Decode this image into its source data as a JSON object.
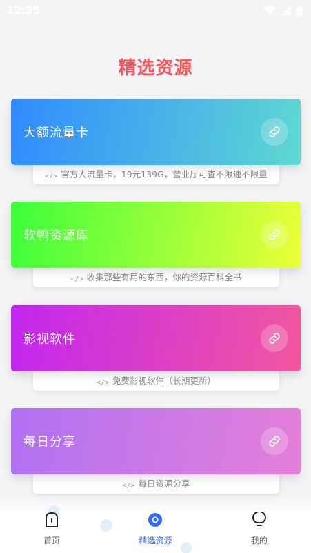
{
  "status_bar": {
    "time": "12:35"
  },
  "page_title": "精选资源",
  "cards": [
    {
      "label": "大额流量卡",
      "description": "官方大流量卡，19元139G，营业厅可查不限速不限量",
      "gradient_start": "#2f8bff",
      "gradient_end": "#5fd8d2"
    },
    {
      "label": "软鸭资源库",
      "description": "收集那些有用的东西，你的资源百科全书",
      "gradient_start": "#3bff3b",
      "gradient_end": "#ecff38"
    },
    {
      "label": "影视软件",
      "description": "免费影视软件（长期更新）",
      "gradient_start": "#c226f0",
      "gradient_end": "#f3579e"
    },
    {
      "label": "每日分享",
      "description": "每日资源分享",
      "gradient_start": "#b072f2",
      "gradient_end": "#e47fd9"
    }
  ],
  "tab_bar": {
    "items": [
      {
        "label": "首页",
        "icon": "home-icon",
        "active": false
      },
      {
        "label": "精选资源",
        "icon": "compass-icon",
        "active": true
      },
      {
        "label": "我的",
        "icon": "lightbulb-icon",
        "active": false
      }
    ],
    "active_color": "#2f6bff"
  },
  "colors": {
    "background": "#f4f4f6",
    "title_start": "#f24a7a",
    "title_end": "#f7603a"
  }
}
